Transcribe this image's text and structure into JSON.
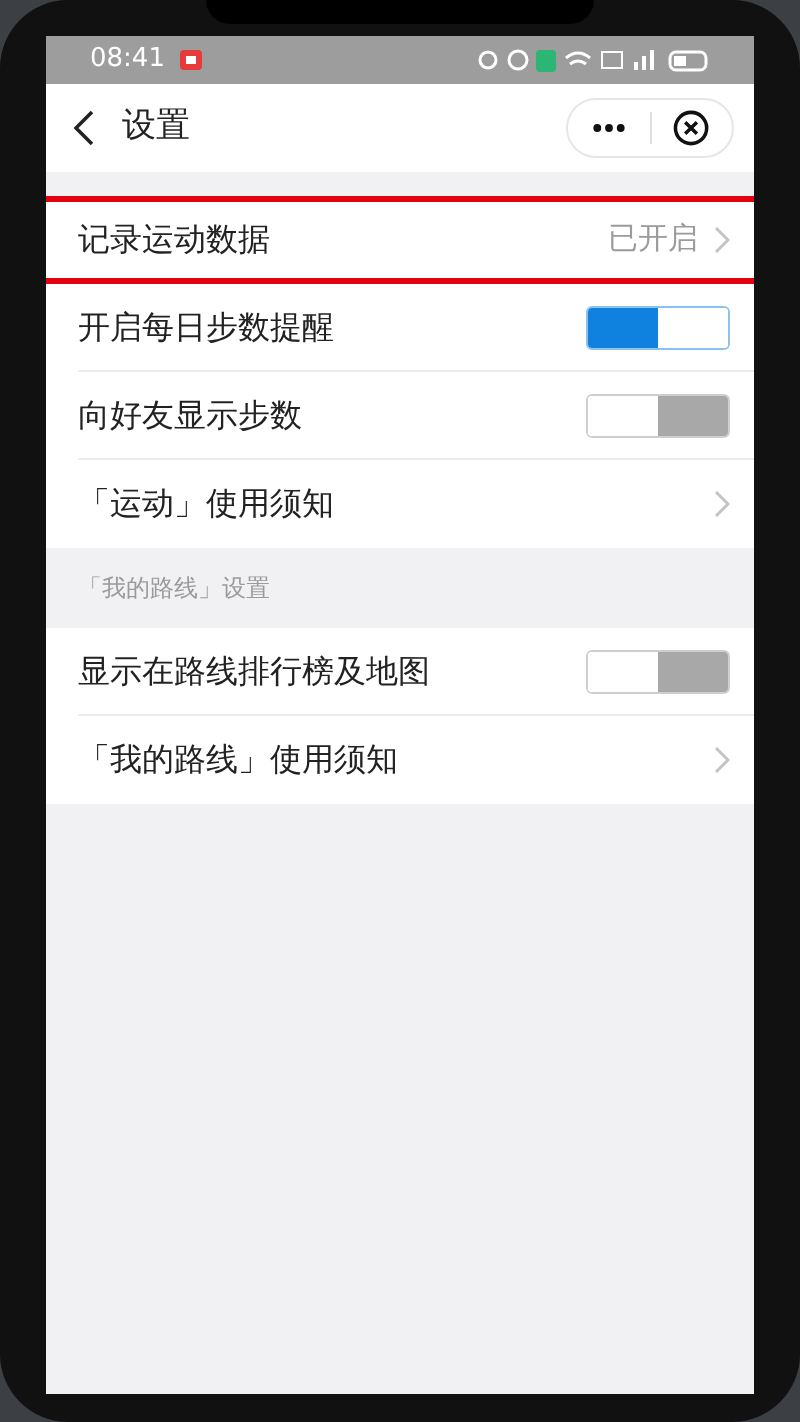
{
  "status_bar": {
    "time": "08:41"
  },
  "nav": {
    "title": "设置"
  },
  "sections": [
    {
      "rows": [
        {
          "kind": "link",
          "label": "记录运动数据",
          "value": "已开启",
          "highlighted": true
        },
        {
          "kind": "switch",
          "label": "开启每日步数提醒",
          "on": true,
          "highlighted": false
        },
        {
          "kind": "switch",
          "label": "向好友显示步数",
          "on": false,
          "highlighted": false
        },
        {
          "kind": "link",
          "label": "「运动」使用须知",
          "highlighted": false
        }
      ]
    },
    {
      "header": "「我的路线」设置",
      "rows": [
        {
          "kind": "switch",
          "label": "显示在路线排行榜及地图",
          "on": false,
          "highlighted": false
        },
        {
          "kind": "link",
          "label": "「我的路线」使用须知",
          "highlighted": false
        }
      ]
    }
  ]
}
